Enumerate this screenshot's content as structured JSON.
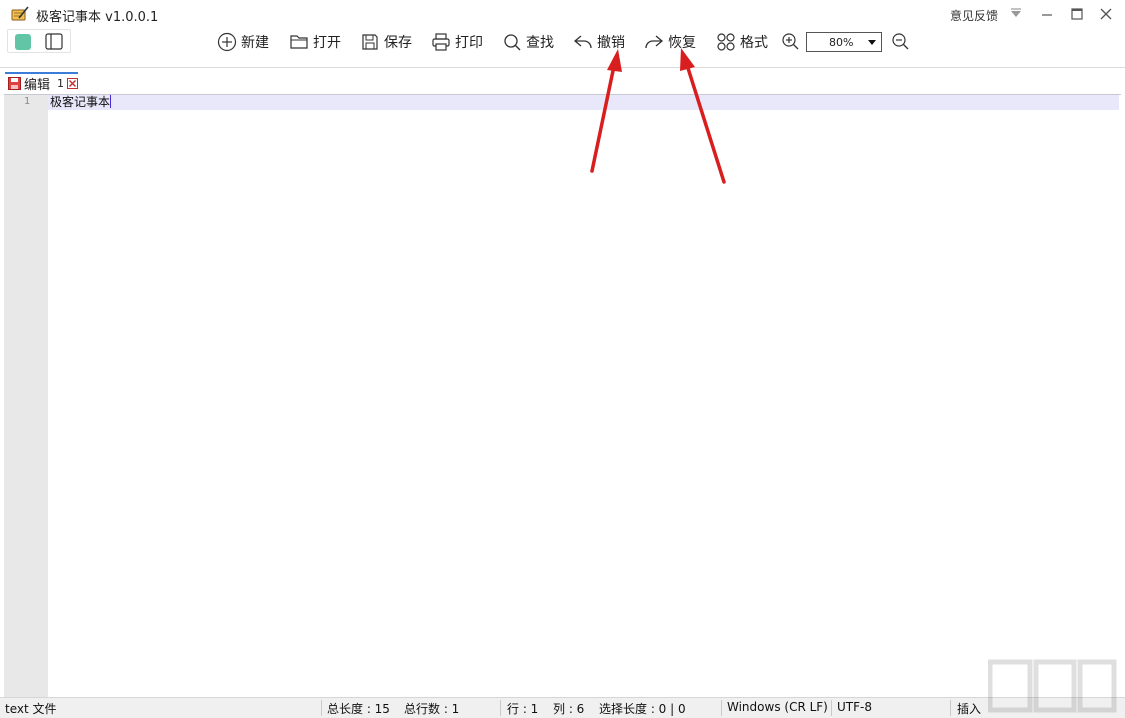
{
  "window": {
    "title": "极客记事本 v1.0.0.1",
    "feedback_label": "意见反馈"
  },
  "toolbar": {
    "new_label": "新建",
    "open_label": "打开",
    "save_label": "保存",
    "print_label": "打印",
    "find_label": "查找",
    "undo_label": "撤销",
    "redo_label": "恢复",
    "format_label": "格式",
    "zoom_value": "80%"
  },
  "tab": {
    "label": "编辑",
    "number": "1"
  },
  "editor": {
    "line_number": "1",
    "text": "极客记事本"
  },
  "statusbar": {
    "file_type": "text 文件",
    "total_length": "总长度 : 15",
    "total_lines": "总行数 : 1",
    "row": "行 : 1",
    "col": "列 : 6",
    "selection": "选择长度 : 0 | 0",
    "line_ending": "Windows (CR LF)",
    "encoding": "UTF-8",
    "insert_mode": "插入"
  },
  "colors": {
    "accent_green": "#62c5a6",
    "tab_accent": "#3b7dd8",
    "annotation_red": "#d81e1e",
    "current_line": "#e8e8fa"
  }
}
